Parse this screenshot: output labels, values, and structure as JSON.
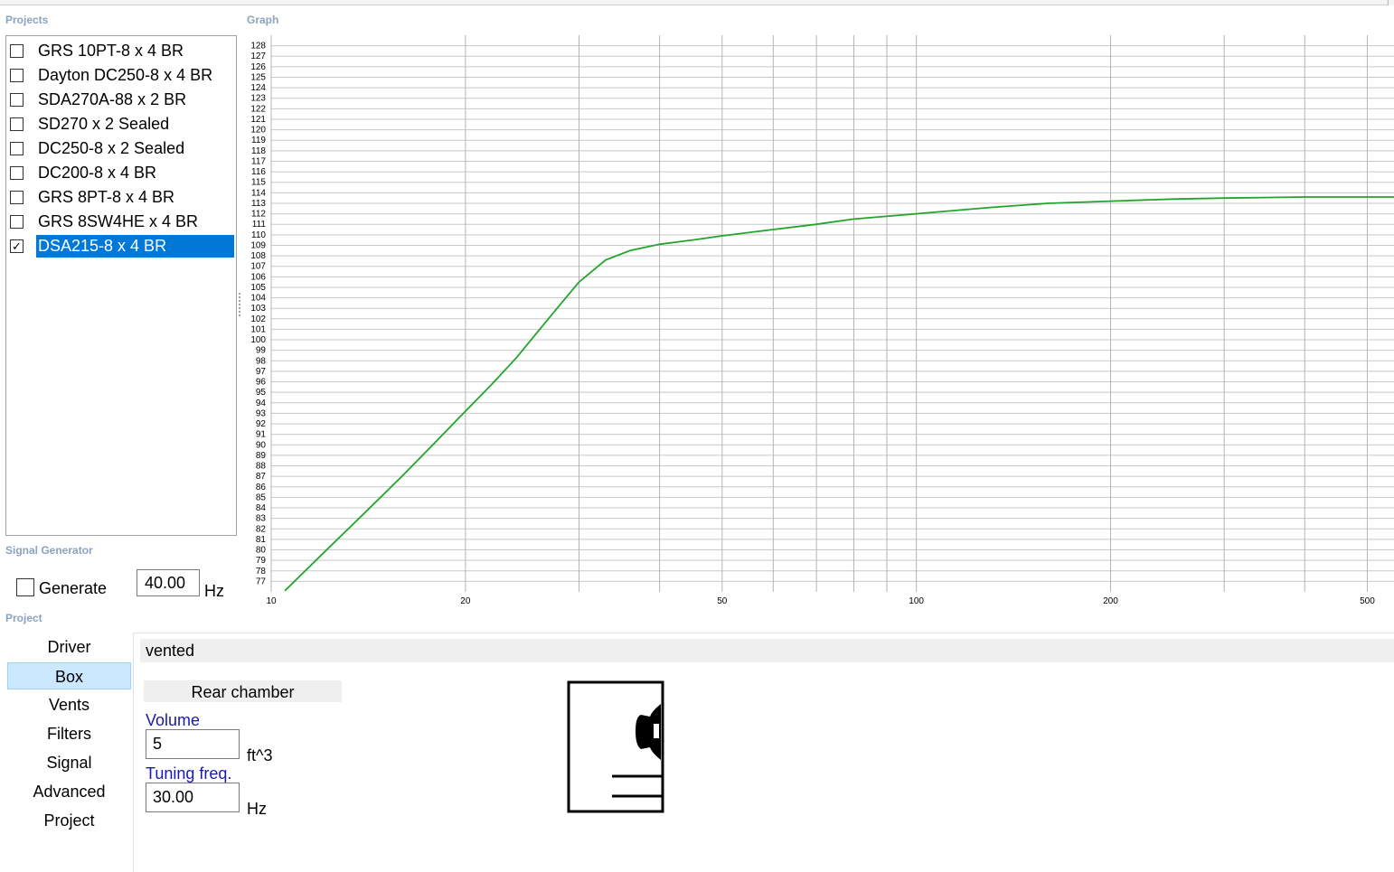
{
  "sections": {
    "projects": "Projects",
    "graph": "Graph",
    "signal_generator": "Signal Generator",
    "project": "Project"
  },
  "projects": [
    {
      "label": "GRS 10PT-8 x 4 BR",
      "checked": false
    },
    {
      "label": "Dayton DC250-8 x 4 BR",
      "checked": false
    },
    {
      "label": "SDA270A-88 x 2 BR",
      "checked": false
    },
    {
      "label": "SD270 x 2 Sealed",
      "checked": false
    },
    {
      "label": "DC250-8 x 2 Sealed",
      "checked": false
    },
    {
      "label": "DC200-8 x 4 BR",
      "checked": false
    },
    {
      "label": "GRS 8PT-8 x 4 BR",
      "checked": false
    },
    {
      "label": "GRS 8SW4HE x 4 BR",
      "checked": false
    },
    {
      "label": "DSA215-8 x 4 BR",
      "checked": true,
      "selected": true
    }
  ],
  "signal_generator": {
    "generate_label": "Generate",
    "generate_checked": false,
    "frequency_value": "40.00",
    "frequency_unit": "Hz"
  },
  "project_nav": [
    {
      "label": "Driver",
      "selected": false
    },
    {
      "label": "Box",
      "selected": true
    },
    {
      "label": "Vents",
      "selected": false
    },
    {
      "label": "Filters",
      "selected": false
    },
    {
      "label": "Signal",
      "selected": false
    },
    {
      "label": "Advanced",
      "selected": false
    },
    {
      "label": "Project",
      "selected": false
    }
  ],
  "box": {
    "type_label": "vented",
    "chamber_label": "Rear chamber",
    "volume_label": "Volume",
    "volume_value": "5",
    "volume_unit": "ft^3",
    "tuning_label": "Tuning freq.",
    "tuning_value": "30.00",
    "tuning_unit": "Hz"
  },
  "colors": {
    "selection": "#0078d7",
    "nav_selection": "#cce8ff",
    "curve": "#22a52a",
    "label_blue": "#1a1aa8",
    "section_label": "#8aa3bf"
  },
  "chart_data": {
    "type": "line",
    "x_scale": "log",
    "xlim": [
      10,
      550
    ],
    "ylim": [
      76,
      129
    ],
    "x_ticks": [
      10,
      20,
      50,
      100,
      200,
      500
    ],
    "x_gridlines": [
      10,
      20,
      30,
      40,
      50,
      60,
      70,
      80,
      90,
      100,
      200,
      300,
      400,
      500
    ],
    "y_ticks": [
      77,
      78,
      79,
      80,
      81,
      82,
      83,
      84,
      85,
      86,
      87,
      88,
      89,
      90,
      91,
      92,
      93,
      94,
      95,
      96,
      97,
      98,
      99,
      100,
      101,
      102,
      103,
      104,
      105,
      106,
      107,
      108,
      109,
      110,
      111,
      112,
      113,
      114,
      115,
      116,
      117,
      118,
      119,
      120,
      121,
      122,
      123,
      124,
      125,
      126,
      127,
      128
    ],
    "grid": true,
    "series": [
      {
        "x": [
          10.5,
          12,
          14,
          16,
          18,
          20,
          22,
          24,
          26,
          28,
          30,
          33,
          36,
          40,
          45,
          50,
          60,
          70,
          80,
          100,
          130,
          160,
          200,
          250,
          300,
          400,
          500,
          550
        ],
        "y": [
          76.1,
          79.6,
          83.6,
          87.1,
          90.3,
          93.2,
          95.8,
          98.3,
          100.9,
          103.3,
          105.5,
          107.6,
          108.5,
          109.1,
          109.5,
          109.9,
          110.5,
          111.0,
          111.5,
          112.0,
          112.6,
          113.0,
          113.2,
          113.4,
          113.5,
          113.6,
          113.6,
          113.6
        ]
      }
    ]
  }
}
